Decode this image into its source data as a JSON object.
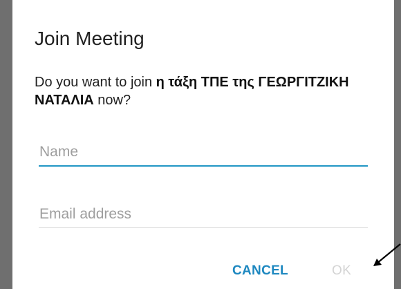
{
  "dialog": {
    "title": "Join Meeting",
    "message_prefix": "Do you want to join ",
    "meeting_name": "η τάξη ΤΠΕ της ΓΕΩΡΓΙΤΖΙΚΗ ΝΑΤΑΛΙΑ",
    "message_suffix": " now?",
    "name_field": {
      "value": "",
      "placeholder": "Name"
    },
    "email_field": {
      "value": "",
      "placeholder": "Email address"
    },
    "cancel_label": "CANCEL",
    "ok_label": "OK"
  },
  "colors": {
    "accent": "#1e88c0",
    "focused_underline": "#2196c4",
    "disabled_text": "#d4d4d4",
    "scrim": "#6f6f6f"
  },
  "annotation": {
    "icon": "arrow-icon"
  }
}
